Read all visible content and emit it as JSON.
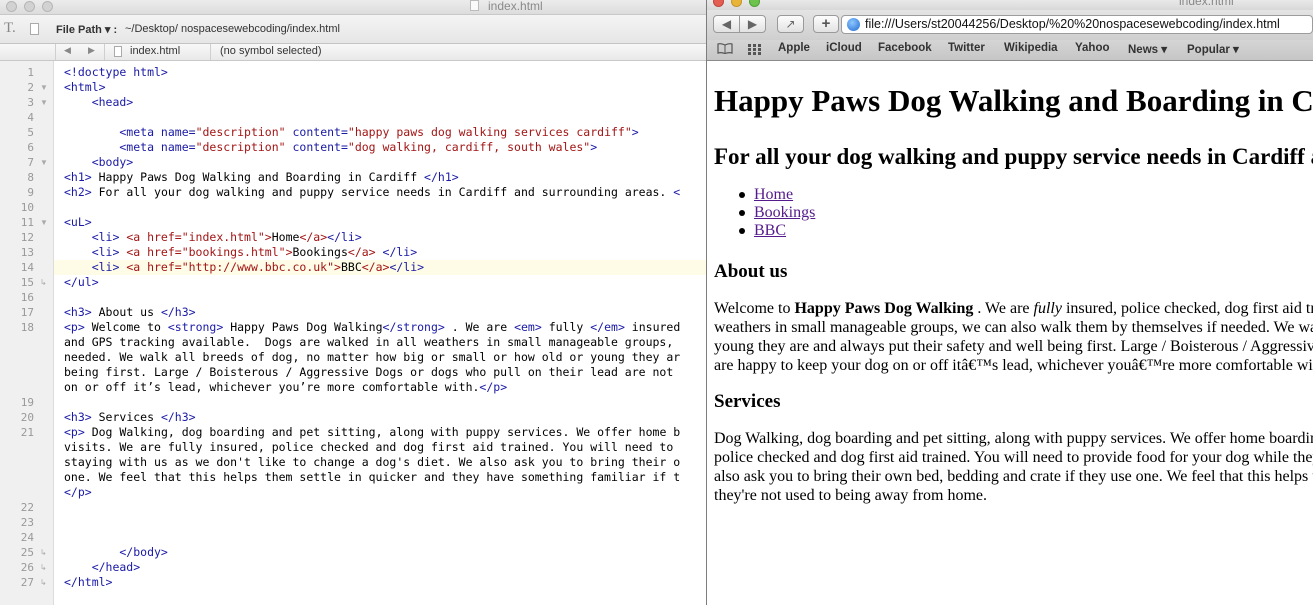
{
  "editor": {
    "window_title": "index.html",
    "path_label": "File Path ▾ :",
    "path_value": "~/Desktop/  nospacesewebcoding/index.html",
    "jump_file": "index.html",
    "jump_symbol": "(no symbol selected)",
    "line_numbers": [
      "1",
      "2",
      "3",
      "4",
      "5",
      "6",
      "7",
      "8",
      "9",
      "10",
      "11",
      "12",
      "13",
      "14",
      "15",
      "16",
      "17",
      "18",
      "19",
      "20",
      "21",
      "22",
      "23",
      "24",
      "25",
      "26",
      "27"
    ],
    "code": {
      "l1": "<!doctype html>",
      "l2": "<html>",
      "l3": "    <head>",
      "l5a": "        <meta name=",
      "l5b": "\"description\"",
      "l5c": " content=",
      "l5d": "\"happy paws dog walking services cardiff\"",
      "l5e": ">",
      "l6a": "        <meta name=",
      "l6b": "\"description\"",
      "l6c": " content=",
      "l6d": "\"dog walking, cardiff, south wales\"",
      "l6e": ">",
      "l7": "    <body>",
      "l8a": "<h1>",
      "l8b": " Happy Paws Dog Walking and Boarding in Cardiff ",
      "l8c": "</h1>",
      "l9a": "<h2>",
      "l9b": " For all your dog walking and puppy service needs in Cardiff and surrounding areas. ",
      "l9c": "<",
      "l11": "<uL>",
      "l12a": "    <li> ",
      "l12b": "<a href=",
      "l12c": "\"index.html\"",
      "l12d": ">",
      "l12e": "Home",
      "l12f": "</a>",
      "l12g": "</li>",
      "l13a": "    <li> ",
      "l13b": "<a href=",
      "l13c": "\"bookings.html\"",
      "l13d": ">",
      "l13e": "Bookings",
      "l13f": "</a>",
      "l13g": " </li>",
      "l14a": "    <li> ",
      "l14b": "<a href=",
      "l14c": "\"http://www.bbc.co.uk\"",
      "l14d": ">",
      "l14e": "BBC",
      "l14f": "</a>",
      "l14g": "</li>",
      "l15": "</ul>",
      "l17a": "<h3>",
      "l17b": " About us ",
      "l17c": "</h3>",
      "l18a": "<p>",
      "l18b": " Welcome to ",
      "l18c": "<strong>",
      "l18d": " Happy Paws Dog Walking",
      "l18e": "</strong>",
      "l18f": " . We are ",
      "l18g": "<em>",
      "l18h": " fully ",
      "l18i": "</em>",
      "l18j": " insured",
      "l18k": "and GPS tracking available.  Dogs are walked in all weathers in small manageable groups,",
      "l18l": "needed. We walk all breeds of dog, no matter how big or small or how old or young they ar",
      "l18m": "being first. Large / Boisterous / Aggressive Dogs or dogs who pull on their lead are not",
      "l18n": "on or off it’s lead, whichever you’re more comfortable with.",
      "l18o": "</p>",
      "l20a": "<h3>",
      "l20b": " Services ",
      "l20c": "</h3>",
      "l21a": "<p>",
      "l21b": " Dog Walking, dog boarding and pet sitting, along with puppy services. We offer home b",
      "l21c": "visits. We are fully insured, police checked and dog first aid trained. You will need to",
      "l21d": "staying with us as we don't like to change a dog's diet. We also ask you to bring their o",
      "l21e": "one. We feel that this helps them settle in quicker and they have something familiar if t",
      "l21f": "</p>",
      "l26": "        </body>",
      "l27": "    </head>",
      "l28": "</html>"
    }
  },
  "browser": {
    "window_title": "index.html",
    "url": "file:///Users/st20044256/Desktop/%20%20nospacesewebcoding/index.html",
    "bookmarks": [
      "Apple",
      "iCloud",
      "Facebook",
      "Twitter",
      "Wikipedia",
      "Yahoo",
      "News ▾",
      "Popular ▾"
    ],
    "page": {
      "h1": "Happy Paws Dog Walking and Boarding in Cardiff",
      "h2": "For all your dog walking and puppy service needs in Cardiff and surrounding areas.",
      "nav": [
        "Home",
        "Bookings",
        "BBC"
      ],
      "about_heading": "About us",
      "about_p1_pre": "Welcome to ",
      "about_p1_strong": "Happy Paws Dog Walking",
      "about_p1_mid": " . We are ",
      "about_p1_em": "fully",
      "about_p1_post": " insured, police checked, dog first aid trained",
      "about_l2": "weathers in small manageable groups, we can also walk them by themselves if needed. We walk all",
      "about_l3": "young they are and always put their safety and well being first. Large / Boisterous / Aggressive Dogs",
      "about_l4": "are happy to keep your dog on or off itâ€™s lead, whichever youâ€™re more comfortable with.",
      "services_heading": "Services",
      "services_l1": "Dog Walking, dog boarding and pet sitting, along with puppy services. We offer home boarding",
      "services_l2": "police checked and dog first aid trained. You will need to provide food for your dog while they",
      "services_l3": "also ask you to bring their own bed, bedding and crate if they use one. We feel that this helps them",
      "services_l4": "they're not used to being away from home."
    }
  }
}
